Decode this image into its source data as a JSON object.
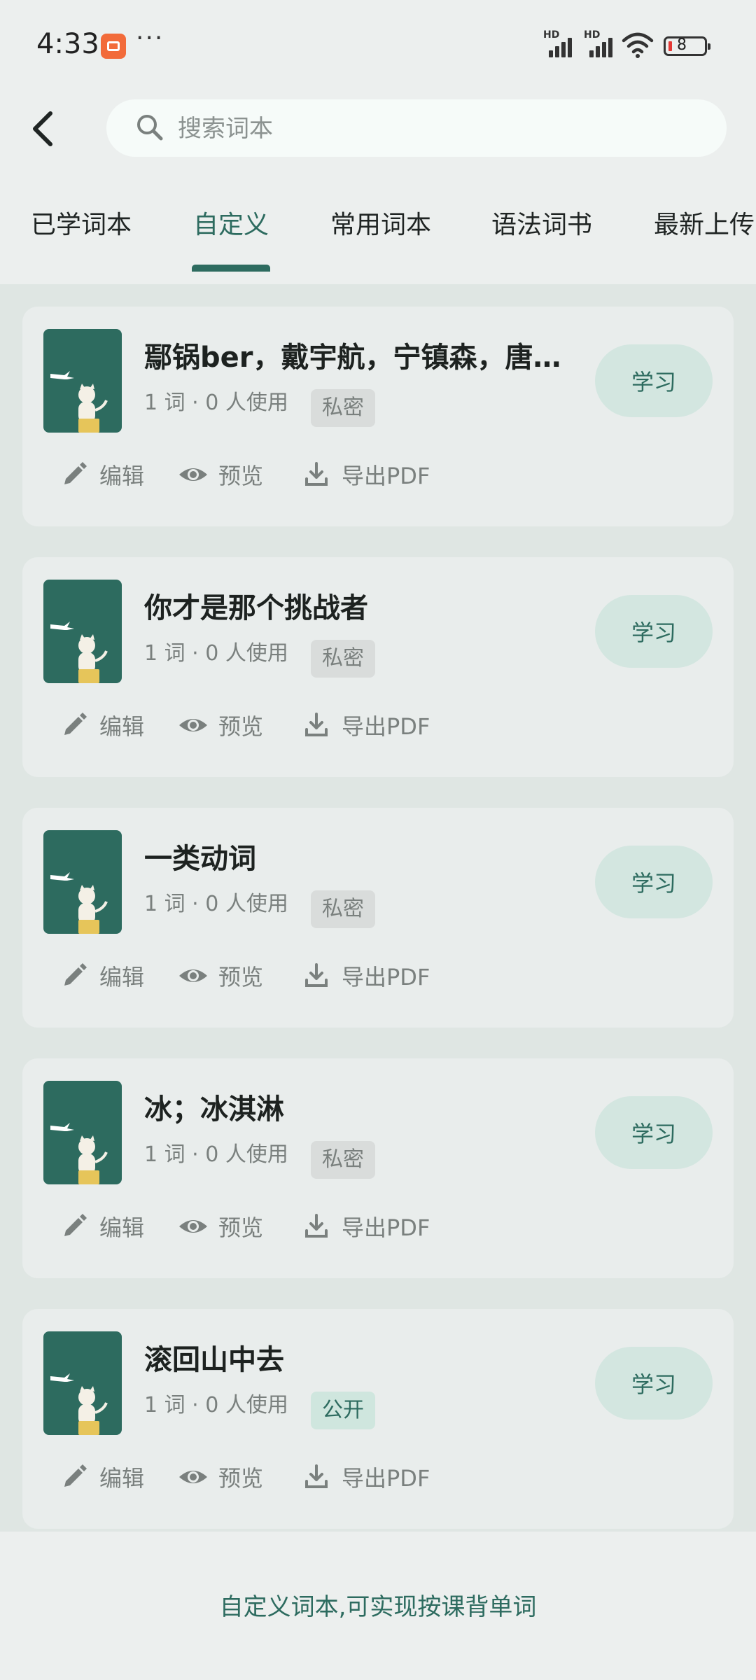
{
  "status_bar": {
    "time": "4:33",
    "more": "···",
    "signal1_label": "HD",
    "signal2_label": "HD",
    "battery": "8"
  },
  "search": {
    "placeholder": "搜索词本"
  },
  "tabs": [
    {
      "label": "已学词本"
    },
    {
      "label": "自定义"
    },
    {
      "label": "常用词本"
    },
    {
      "label": "语法词书"
    },
    {
      "label": "最新上传"
    }
  ],
  "active_tab": "自定义",
  "cards": [
    {
      "title": "鄢锅ber，戴宇航，宁镇森，唐…",
      "meta": "1 词 · 0 人使用",
      "tag": "私密",
      "study": "学习",
      "edit": "编辑",
      "preview": "预览",
      "export": "导出PDF"
    },
    {
      "title": "你才是那个挑战者",
      "meta": "1 词 · 0 人使用",
      "tag": "私密",
      "study": "学习",
      "edit": "编辑",
      "preview": "预览",
      "export": "导出PDF"
    },
    {
      "title": "一类动词",
      "meta": "1 词 · 0 人使用",
      "tag": "私密",
      "study": "学习",
      "edit": "编辑",
      "preview": "预览",
      "export": "导出PDF"
    },
    {
      "title": "冰；冰淇淋",
      "meta": "1 词 · 0 人使用",
      "tag": "私密",
      "study": "学习",
      "edit": "编辑",
      "preview": "预览",
      "export": "导出PDF"
    },
    {
      "title": "滚回山中去",
      "meta": "1 词 · 0 人使用",
      "tag": "公开",
      "study": "学习",
      "edit": "编辑",
      "preview": "预览",
      "export": "导出PDF"
    }
  ],
  "footer": {
    "text": "自定义词本,可实现按课背单词"
  },
  "colors": {
    "accent": "#2D6B5F",
    "background": "#ECEFEE",
    "card": "#E9EDEC",
    "study_button": "#D3E6E0"
  }
}
